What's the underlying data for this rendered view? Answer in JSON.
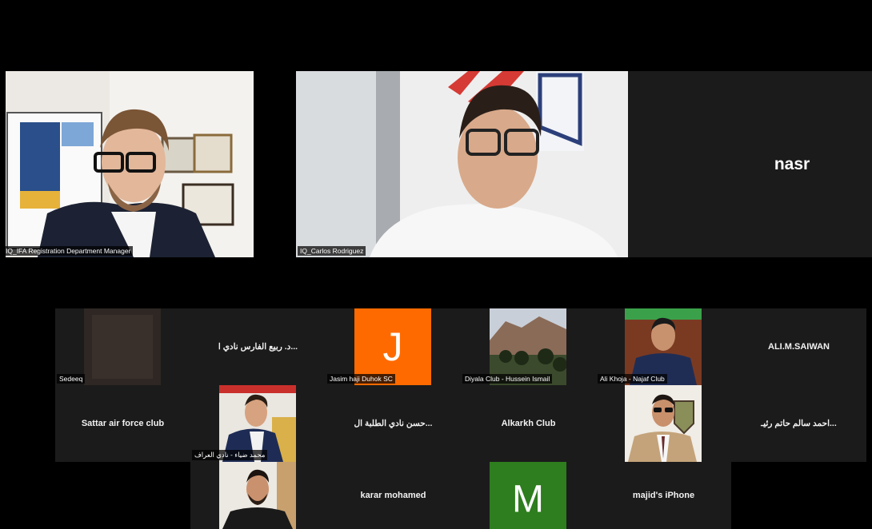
{
  "top_row": {
    "tile1": {
      "tag": "IQ_IFA Registration Department Manager"
    },
    "tile2": {
      "tag": "IQ_Carlos Rodriguez"
    },
    "tile3": {
      "name": "nasr"
    }
  },
  "gallery": {
    "r1c1": {
      "tag": "Sedeeq"
    },
    "r1c2": {
      "name": "د. ربيع الفارس نادي ا..."
    },
    "r1c3": {
      "tag": "Jasim haji Duhok SC",
      "avatar_letter": "J",
      "avatar_color": "#ff6a00"
    },
    "r1c4": {
      "tag": "Diyala Club - Hussein Ismail"
    },
    "r1c5": {
      "tag": "Ali Khoja - Najaf Club"
    },
    "r1c6": {
      "name": "ALI.M.SAIWAN"
    },
    "r2c1": {
      "name": "Sattar air force club"
    },
    "r2c2": {
      "tag": "محمد ضياء - نادي العراف"
    },
    "r2c3": {
      "name": "حسن  نادي الطلبة ال..."
    },
    "r2c4": {
      "name": "Alkarkh Club"
    },
    "r2c5": {
      "tag": ""
    },
    "r2c6": {
      "name": "احمد سالم حاتم رئيـ..."
    },
    "r3c1": {
      "tag": ""
    },
    "r3c2": {
      "name": "karar mohamed"
    },
    "r3c3": {
      "avatar_letter": "M",
      "avatar_color": "#2e7d1e"
    },
    "r3c4": {
      "name": "majid's iPhone"
    }
  },
  "colors": {
    "background": "#000000",
    "tile_bg": "#1a1a1a",
    "tag_bg": "rgba(0,0,0,0.72)"
  }
}
